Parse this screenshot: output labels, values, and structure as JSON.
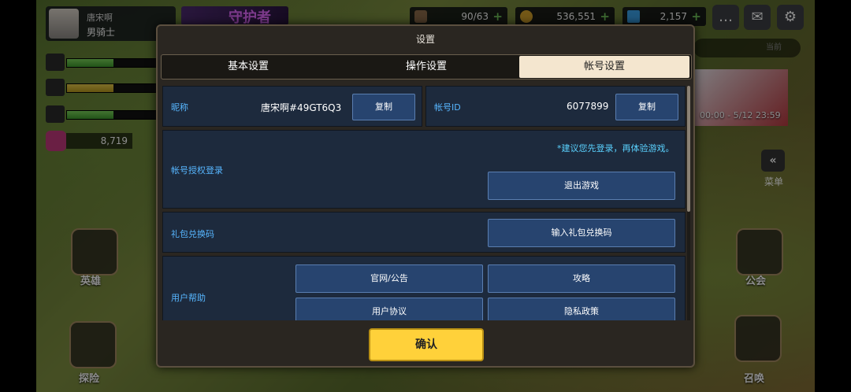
{
  "hud": {
    "player_name": "唐宋啊",
    "player_class": "男骑士",
    "event_banner": "守护者",
    "stamina": "90/63",
    "gold": "536,551",
    "diamonds": "2,157",
    "gem_count": "8,719",
    "search_placeholder": "当前",
    "banner_time": "00:00 - 5/12 23:59",
    "menu_label": "菜单",
    "left_menu": [
      "英雄",
      "探险"
    ],
    "right_menu": [
      "公会",
      "召唤"
    ]
  },
  "dialog": {
    "title": "设置",
    "tabs": [
      {
        "label": "基本设置",
        "active": false
      },
      {
        "label": "操作设置",
        "active": false
      },
      {
        "label": "帐号设置",
        "active": true
      }
    ],
    "nickname": {
      "label": "昵称",
      "value": "唐宋啊#49GT6Q3",
      "copy": "复制"
    },
    "account_id": {
      "label": "帐号ID",
      "value": "6077899",
      "copy": "复制"
    },
    "auth": {
      "label": "帐号授权登录",
      "hint": "*建议您先登录，再体验游戏。",
      "button": "退出游戏"
    },
    "gift": {
      "label": "礼包兑换码",
      "button": "输入礼包兑换码"
    },
    "help": {
      "label": "用户帮助",
      "buttons": [
        "官网/公告",
        "攻略",
        "用户协议",
        "隐私政策"
      ]
    },
    "confirm": "确认"
  },
  "colors": {
    "accent_blue": "#57b6ff",
    "panel": "#1d2a3d",
    "button": "#27446f",
    "confirm": "#ffd13a",
    "tab_active": "#f4e6cf"
  }
}
